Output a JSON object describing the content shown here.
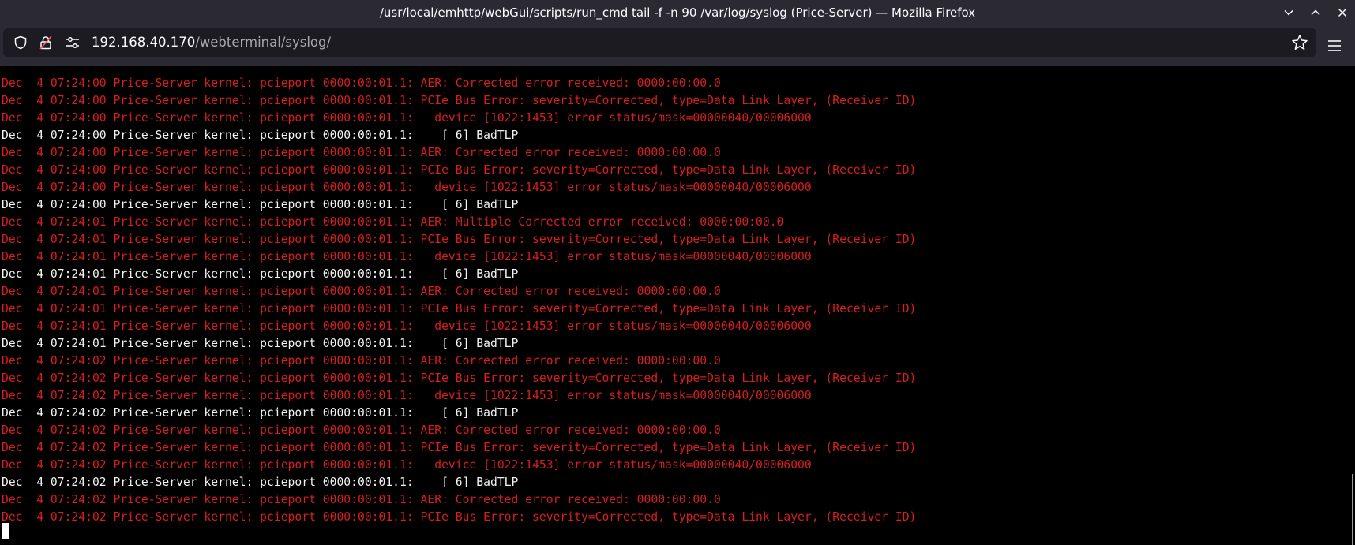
{
  "window": {
    "title": "/usr/local/emhttp/webGui/scripts/run_cmd tail -f -n 90 /var/log/syslog (Price-Server) — Mozilla Firefox",
    "controls": [
      "minimize",
      "maximize",
      "close"
    ]
  },
  "navbar": {
    "url_host": "192.168.40.170",
    "url_path": "/webterminal/syslog/",
    "icons": [
      "shield-icon",
      "insecure-lock-icon",
      "site-permissions-icon",
      "bookmark-star-icon",
      "hamburger-menu-icon"
    ]
  },
  "terminal": {
    "colors": {
      "error": "#d81e1e",
      "normal": "#f2f2f2",
      "background": "#000000"
    },
    "lines": [
      {
        "kind": "err",
        "text": "Dec  4 07:24:00 Price-Server kernel: pcieport 0000:00:01.1: AER: Corrected error received: 0000:00:00.0"
      },
      {
        "kind": "err",
        "text": "Dec  4 07:24:00 Price-Server kernel: pcieport 0000:00:01.1: PCIe Bus Error: severity=Corrected, type=Data Link Layer, (Receiver ID)"
      },
      {
        "kind": "err",
        "text": "Dec  4 07:24:00 Price-Server kernel: pcieport 0000:00:01.1:   device [1022:1453] error status/mask=00000040/00006000"
      },
      {
        "kind": "info",
        "text": "Dec  4 07:24:00 Price-Server kernel: pcieport 0000:00:01.1:    [ 6] BadTLP"
      },
      {
        "kind": "err",
        "text": "Dec  4 07:24:00 Price-Server kernel: pcieport 0000:00:01.1: AER: Corrected error received: 0000:00:00.0"
      },
      {
        "kind": "err",
        "text": "Dec  4 07:24:00 Price-Server kernel: pcieport 0000:00:01.1: PCIe Bus Error: severity=Corrected, type=Data Link Layer, (Receiver ID)"
      },
      {
        "kind": "err",
        "text": "Dec  4 07:24:00 Price-Server kernel: pcieport 0000:00:01.1:   device [1022:1453] error status/mask=00000040/00006000"
      },
      {
        "kind": "info",
        "text": "Dec  4 07:24:00 Price-Server kernel: pcieport 0000:00:01.1:    [ 6] BadTLP"
      },
      {
        "kind": "err",
        "text": "Dec  4 07:24:01 Price-Server kernel: pcieport 0000:00:01.1: AER: Multiple Corrected error received: 0000:00:00.0"
      },
      {
        "kind": "err",
        "text": "Dec  4 07:24:01 Price-Server kernel: pcieport 0000:00:01.1: PCIe Bus Error: severity=Corrected, type=Data Link Layer, (Receiver ID)"
      },
      {
        "kind": "err",
        "text": "Dec  4 07:24:01 Price-Server kernel: pcieport 0000:00:01.1:   device [1022:1453] error status/mask=00000040/00006000"
      },
      {
        "kind": "info",
        "text": "Dec  4 07:24:01 Price-Server kernel: pcieport 0000:00:01.1:    [ 6] BadTLP"
      },
      {
        "kind": "err",
        "text": "Dec  4 07:24:01 Price-Server kernel: pcieport 0000:00:01.1: AER: Corrected error received: 0000:00:00.0"
      },
      {
        "kind": "err",
        "text": "Dec  4 07:24:01 Price-Server kernel: pcieport 0000:00:01.1: PCIe Bus Error: severity=Corrected, type=Data Link Layer, (Receiver ID)"
      },
      {
        "kind": "err",
        "text": "Dec  4 07:24:01 Price-Server kernel: pcieport 0000:00:01.1:   device [1022:1453] error status/mask=00000040/00006000"
      },
      {
        "kind": "info",
        "text": "Dec  4 07:24:01 Price-Server kernel: pcieport 0000:00:01.1:    [ 6] BadTLP"
      },
      {
        "kind": "err",
        "text": "Dec  4 07:24:02 Price-Server kernel: pcieport 0000:00:01.1: AER: Corrected error received: 0000:00:00.0"
      },
      {
        "kind": "err",
        "text": "Dec  4 07:24:02 Price-Server kernel: pcieport 0000:00:01.1: PCIe Bus Error: severity=Corrected, type=Data Link Layer, (Receiver ID)"
      },
      {
        "kind": "err",
        "text": "Dec  4 07:24:02 Price-Server kernel: pcieport 0000:00:01.1:   device [1022:1453] error status/mask=00000040/00006000"
      },
      {
        "kind": "info",
        "text": "Dec  4 07:24:02 Price-Server kernel: pcieport 0000:00:01.1:    [ 6] BadTLP"
      },
      {
        "kind": "err",
        "text": "Dec  4 07:24:02 Price-Server kernel: pcieport 0000:00:01.1: AER: Corrected error received: 0000:00:00.0"
      },
      {
        "kind": "err",
        "text": "Dec  4 07:24:02 Price-Server kernel: pcieport 0000:00:01.1: PCIe Bus Error: severity=Corrected, type=Data Link Layer, (Receiver ID)"
      },
      {
        "kind": "err",
        "text": "Dec  4 07:24:02 Price-Server kernel: pcieport 0000:00:01.1:   device [1022:1453] error status/mask=00000040/00006000"
      },
      {
        "kind": "info",
        "text": "Dec  4 07:24:02 Price-Server kernel: pcieport 0000:00:01.1:    [ 6] BadTLP"
      },
      {
        "kind": "err",
        "text": "Dec  4 07:24:02 Price-Server kernel: pcieport 0000:00:01.1: AER: Corrected error received: 0000:00:00.0"
      },
      {
        "kind": "err",
        "text": "Dec  4 07:24:02 Price-Server kernel: pcieport 0000:00:01.1: PCIe Bus Error: severity=Corrected, type=Data Link Layer, (Receiver ID)"
      }
    ]
  }
}
